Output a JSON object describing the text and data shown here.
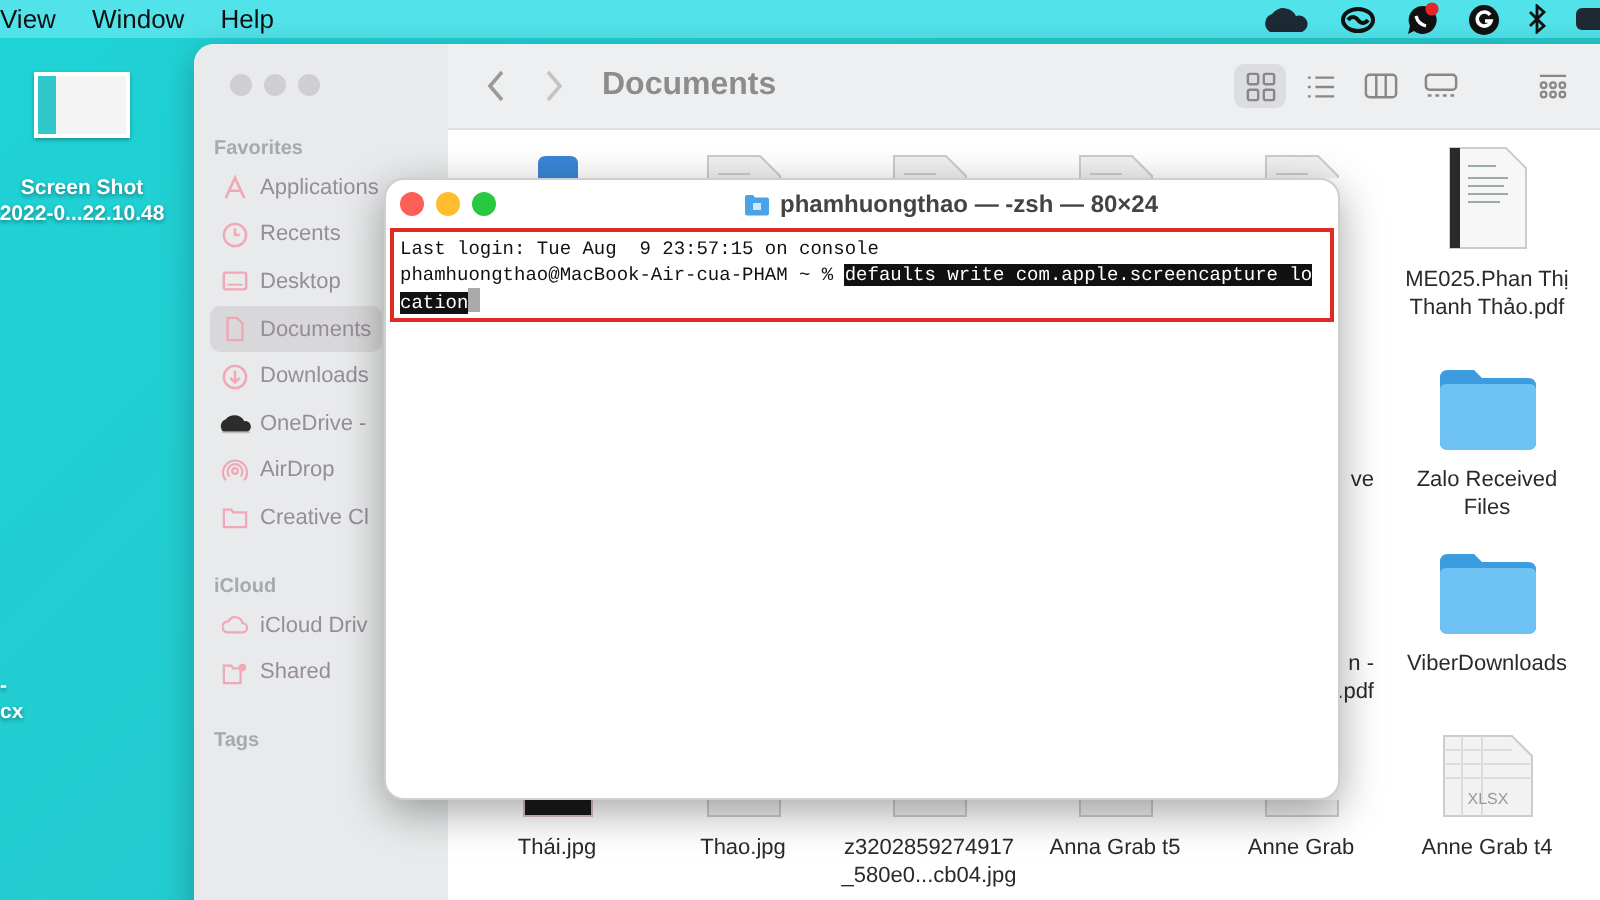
{
  "menu_bar": {
    "items": [
      "View",
      "Window",
      "Help"
    ],
    "viber_notification": true
  },
  "desktop": {
    "icons": [
      {
        "label_lines": [
          "Screen Shot",
          "2022-0...22.10.48"
        ]
      }
    ],
    "cut_label_lines": [
      "-",
      "cx"
    ]
  },
  "finder": {
    "title": "Documents",
    "view_buttons": [
      {
        "selected": true
      },
      {
        "selected": false
      },
      {
        "selected": false
      },
      {
        "selected": false
      },
      {
        "selected": false
      }
    ],
    "sidebar": [
      {
        "heading": "Favorites",
        "items": [
          {
            "label": "Applications",
            "selected": false
          },
          {
            "label": "Recents",
            "selected": false
          },
          {
            "label": "Desktop",
            "selected": false
          },
          {
            "label": "Documents",
            "selected": true
          },
          {
            "label": "Downloads",
            "selected": false
          },
          {
            "label": "OneDrive -",
            "selected": false
          },
          {
            "label": "AirDrop",
            "selected": false
          },
          {
            "label": "Creative Cl",
            "selected": false
          }
        ]
      },
      {
        "heading": "iCloud",
        "items": [
          {
            "label": "iCloud Driv",
            "selected": false
          },
          {
            "label": "Shared",
            "selected": false
          }
        ]
      },
      {
        "heading": "Tags"
      }
    ],
    "file_rows": [
      {
        "items": [
          {
            "kind": "blue-top"
          },
          {
            "kind": "doc-top"
          },
          {
            "kind": "doc-top"
          },
          {
            "kind": "doc-top"
          },
          {
            "kind": "doc-top"
          },
          {
            "kind": "pdf",
            "label_lines": [
              "ME025.Phan Thị",
              "Thanh Thảo.pdf"
            ],
            "clipped": false
          }
        ]
      },
      {
        "items": [
          {
            "kind": "doc",
            "label_lines": [
              "ve"
            ],
            "clipped": true
          },
          {
            "kind": "folder",
            "label_lines": [
              "Zalo Received",
              "Files"
            ],
            "clipped": false
          }
        ]
      },
      {
        "items": [
          {
            "kind": "doc",
            "label_lines": [
              "n -",
              ".pdf"
            ],
            "clipped": true
          },
          {
            "kind": "folder",
            "label_lines": [
              "ViberDownloads"
            ],
            "clipped": false
          }
        ]
      },
      {
        "items": [
          {
            "kind": "image-bottom",
            "label_lines": [
              "Thái.jpg"
            ],
            "clipped": false
          },
          {
            "kind": "doc-bottom",
            "label_lines": [
              "Thao.jpg"
            ],
            "clipped": false
          },
          {
            "kind": "doc-bottom",
            "label_lines": [
              "z3202859274917",
              "_580e0...cb04.jpg"
            ],
            "clipped": false
          },
          {
            "kind": "doc-bottom",
            "label_lines": [
              "Anna Grab t5"
            ],
            "clipped": false
          },
          {
            "kind": "doc-bottom",
            "label_lines": [
              "Anne Grab"
            ],
            "clipped": false
          },
          {
            "kind": "xlsx",
            "icon_text": "XLSX",
            "label_lines": [
              "Anne Grab t4"
            ],
            "clipped": false
          }
        ]
      }
    ]
  },
  "terminal": {
    "title": "phamhuongthao — -zsh — 80×24",
    "highlight_box": true,
    "lines": [
      {
        "segments": [
          {
            "text": "Last login: Tue Aug  9 23:57:15 on console",
            "selected": false
          }
        ],
        "cursor": false
      },
      {
        "segments": [
          {
            "text": "phamhuongthao@MacBook-Air-cua-PHAM ~ % ",
            "selected": false
          },
          {
            "text": "defaults write com.apple.screencapture lo",
            "selected": true
          }
        ],
        "cursor": false
      },
      {
        "segments": [
          {
            "text": "cation",
            "selected": true
          }
        ],
        "cursor": true
      }
    ]
  }
}
